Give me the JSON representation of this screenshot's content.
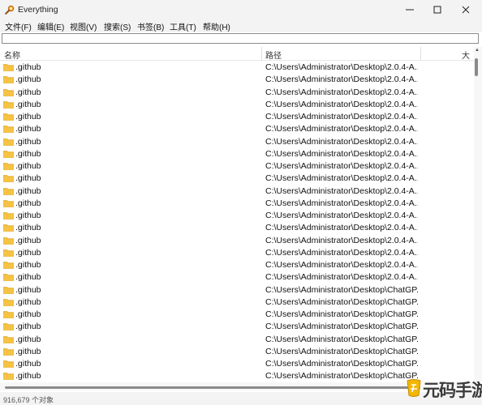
{
  "window": {
    "title": "Everything",
    "controls": {
      "minimize": "minimize-icon",
      "maximize": "maximize-icon",
      "close": "close-icon"
    }
  },
  "menu": [
    {
      "label": "文件(F)"
    },
    {
      "label": "编辑(E)"
    },
    {
      "label": "视图(V)"
    },
    {
      "label": "搜索(S)"
    },
    {
      "label": "书签(B)"
    },
    {
      "label": "工具(T)"
    },
    {
      "label": "帮助(H)"
    }
  ],
  "search": {
    "value": "",
    "placeholder": ""
  },
  "columns": {
    "name": "名称",
    "path": "路径",
    "size": "大"
  },
  "rows": [
    {
      "name": ".github",
      "path": "C:\\Users\\Administrator\\Desktop\\2.0.4-A..."
    },
    {
      "name": ".github",
      "path": "C:\\Users\\Administrator\\Desktop\\2.0.4-A..."
    },
    {
      "name": ".github",
      "path": "C:\\Users\\Administrator\\Desktop\\2.0.4-A..."
    },
    {
      "name": ".github",
      "path": "C:\\Users\\Administrator\\Desktop\\2.0.4-A..."
    },
    {
      "name": ".github",
      "path": "C:\\Users\\Administrator\\Desktop\\2.0.4-A..."
    },
    {
      "name": ".github",
      "path": "C:\\Users\\Administrator\\Desktop\\2.0.4-A..."
    },
    {
      "name": ".github",
      "path": "C:\\Users\\Administrator\\Desktop\\2.0.4-A..."
    },
    {
      "name": ".github",
      "path": "C:\\Users\\Administrator\\Desktop\\2.0.4-A..."
    },
    {
      "name": ".github",
      "path": "C:\\Users\\Administrator\\Desktop\\2.0.4-A..."
    },
    {
      "name": ".github",
      "path": "C:\\Users\\Administrator\\Desktop\\2.0.4-A..."
    },
    {
      "name": ".github",
      "path": "C:\\Users\\Administrator\\Desktop\\2.0.4-A..."
    },
    {
      "name": ".github",
      "path": "C:\\Users\\Administrator\\Desktop\\2.0.4-A..."
    },
    {
      "name": ".github",
      "path": "C:\\Users\\Administrator\\Desktop\\2.0.4-A..."
    },
    {
      "name": ".github",
      "path": "C:\\Users\\Administrator\\Desktop\\2.0.4-A..."
    },
    {
      "name": ".github",
      "path": "C:\\Users\\Administrator\\Desktop\\2.0.4-A..."
    },
    {
      "name": ".github",
      "path": "C:\\Users\\Administrator\\Desktop\\2.0.4-A..."
    },
    {
      "name": ".github",
      "path": "C:\\Users\\Administrator\\Desktop\\2.0.4-A..."
    },
    {
      "name": ".github",
      "path": "C:\\Users\\Administrator\\Desktop\\2.0.4-A..."
    },
    {
      "name": ".github",
      "path": "C:\\Users\\Administrator\\Desktop\\ChatGP..."
    },
    {
      "name": ".github",
      "path": "C:\\Users\\Administrator\\Desktop\\ChatGP..."
    },
    {
      "name": ".github",
      "path": "C:\\Users\\Administrator\\Desktop\\ChatGP..."
    },
    {
      "name": ".github",
      "path": "C:\\Users\\Administrator\\Desktop\\ChatGP..."
    },
    {
      "name": ".github",
      "path": "C:\\Users\\Administrator\\Desktop\\ChatGP..."
    },
    {
      "name": ".github",
      "path": "C:\\Users\\Administrator\\Desktop\\ChatGP..."
    },
    {
      "name": ".github",
      "path": "C:\\Users\\Administrator\\Desktop\\ChatGP..."
    },
    {
      "name": ".github",
      "path": "C:\\Users\\Administrator\\Desktop\\ChatGP..."
    },
    {
      "name": ".github",
      "path": "C:\\Users\\Administrator\\Desktop\\ChatGP..."
    }
  ],
  "status": {
    "text": "916,679 个对象"
  },
  "watermark": {
    "text": "元码手游网"
  },
  "colors": {
    "folder": "#f6c343",
    "folder_dark": "#e0a82a",
    "titlebar": "#f3f3f3"
  }
}
